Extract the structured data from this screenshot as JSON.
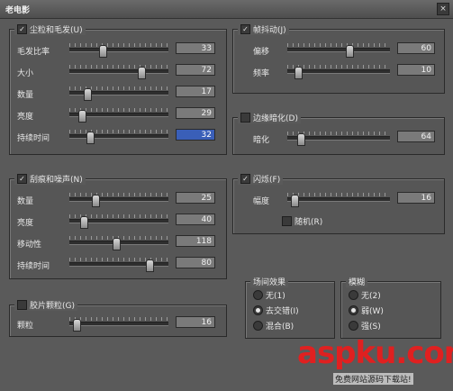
{
  "window": {
    "title": "老电影",
    "close": "×"
  },
  "dust": {
    "header": "尘粒和毛发(U)",
    "rows": [
      {
        "label": "毛发比率",
        "value": "33",
        "pos": 0.33
      },
      {
        "label": "大小",
        "value": "72",
        "pos": 0.72
      },
      {
        "label": "数量",
        "value": "17",
        "pos": 0.17
      },
      {
        "label": "亮度",
        "value": "29",
        "pos": 0.12
      },
      {
        "label": "持续时间",
        "value": "32",
        "pos": 0.2,
        "selected": true
      }
    ]
  },
  "jitter": {
    "header": "帧抖动(J)",
    "rows": [
      {
        "label": "偏移",
        "value": "60",
        "pos": 0.6
      },
      {
        "label": "频率",
        "value": "10",
        "pos": 0.1
      }
    ]
  },
  "edge": {
    "header": "边缘暗化(D)",
    "rows": [
      {
        "label": "暗化",
        "value": "64",
        "pos": 0.12
      }
    ]
  },
  "scratch": {
    "header": "刮痕和噪声(N)",
    "rows": [
      {
        "label": "数量",
        "value": "25",
        "pos": 0.25
      },
      {
        "label": "亮度",
        "value": "40",
        "pos": 0.14
      },
      {
        "label": "移动性",
        "value": "118",
        "pos": 0.46
      },
      {
        "label": "持续时间",
        "value": "80",
        "pos": 0.8
      }
    ]
  },
  "flicker": {
    "header": "闪烁(F)",
    "rows": [
      {
        "label": "幅度",
        "value": "16",
        "pos": 0.06
      }
    ],
    "random_label": "随机(R)"
  },
  "grain": {
    "header": "胶片颗粒(G)",
    "rows": [
      {
        "label": "颗粒",
        "value": "16",
        "pos": 0.06
      }
    ]
  },
  "transition": {
    "header": "场间效果",
    "options": [
      {
        "label": "无(1)",
        "on": false
      },
      {
        "label": "去交错(I)",
        "on": true
      },
      {
        "label": "混合(B)",
        "on": false
      }
    ]
  },
  "blur": {
    "header": "模糊",
    "options": [
      {
        "label": "无(2)",
        "on": false
      },
      {
        "label": "弱(W)",
        "on": true
      },
      {
        "label": "强(S)",
        "on": false
      }
    ]
  },
  "watermark": {
    "text": "aspku.com",
    "sub": "免费网站源码下载站!"
  },
  "check_mark": "✓"
}
